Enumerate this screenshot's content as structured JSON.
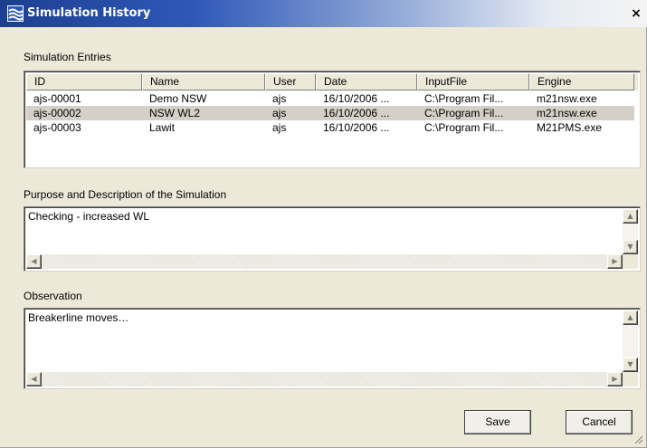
{
  "window": {
    "title": "Simulation History",
    "close_label": "×"
  },
  "entries": {
    "label": "Simulation Entries",
    "columns": [
      "ID",
      "Name",
      "User",
      "Date",
      "InputFile",
      "Engine"
    ],
    "rows": [
      {
        "id": "ajs-00001",
        "name": "Demo NSW",
        "user": "ajs",
        "date": "16/10/2006 ...",
        "input_file": "C:\\Program Fil...",
        "engine": "m21nsw.exe"
      },
      {
        "id": "ajs-00002",
        "name": "NSW WL2",
        "user": "ajs",
        "date": "16/10/2006 ...",
        "input_file": "C:\\Program Fil...",
        "engine": "m21nsw.exe"
      },
      {
        "id": "ajs-00003",
        "name": "Lawit",
        "user": "ajs",
        "date": "16/10/2006 ...",
        "input_file": "C:\\Program Fil...",
        "engine": "M21PMS.exe"
      }
    ],
    "selected_row": 1
  },
  "purpose": {
    "label": "Purpose and Description of the Simulation",
    "value": "Checking - increased WL"
  },
  "observation": {
    "label": "Observation",
    "value": "Breakerline moves…"
  },
  "buttons": {
    "save": "Save",
    "cancel": "Cancel"
  },
  "icons": {
    "title": "simulation-app-icon",
    "close": "close-icon",
    "scroll_up": "arrow-up-icon",
    "scroll_down": "arrow-down-icon",
    "scroll_left": "arrow-left-icon",
    "scroll_right": "arrow-right-icon",
    "grip": "resize-grip-icon"
  },
  "colors": {
    "title_gradient_start": "#1c3f8f",
    "dialog_bg": "#ece9d8",
    "selected_row_bg": "#d4d0c8"
  }
}
